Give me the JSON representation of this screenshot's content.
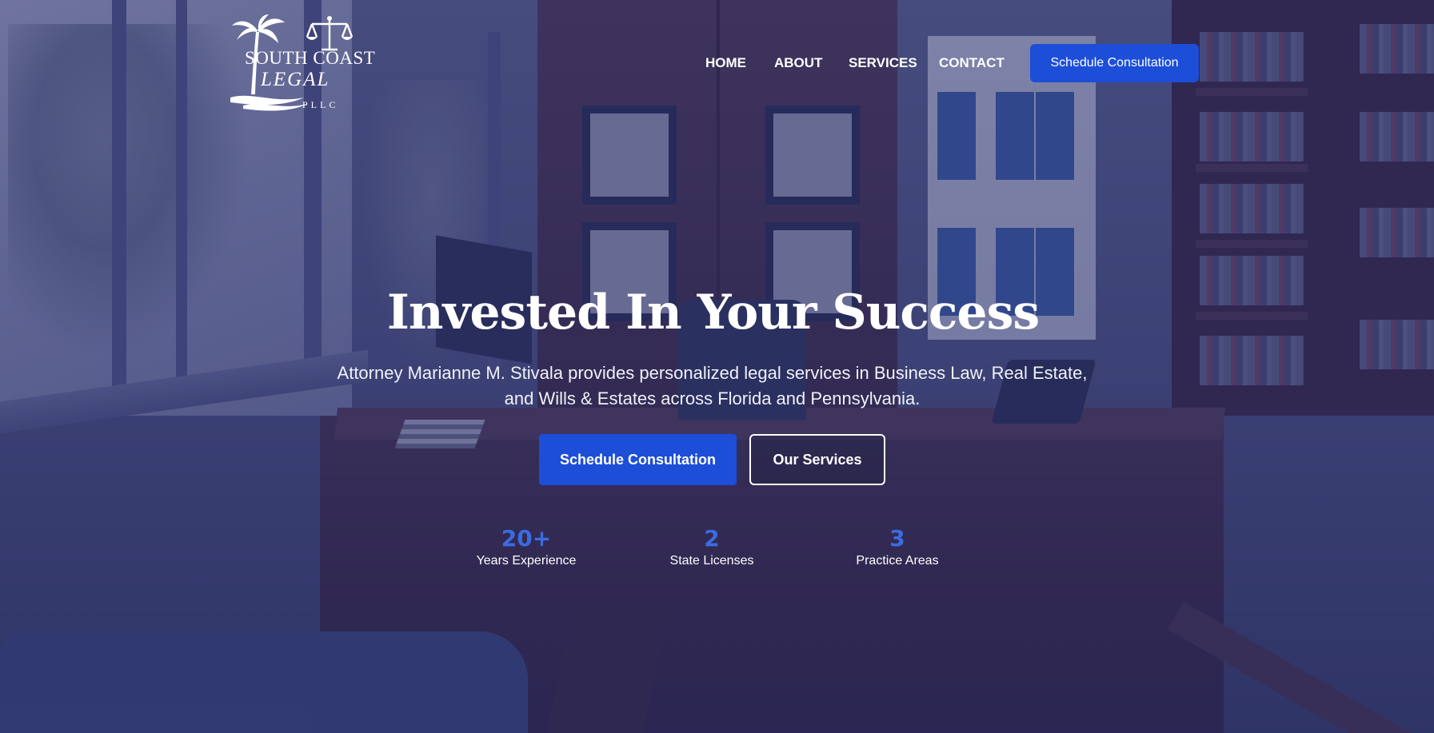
{
  "brand": {
    "logo_line1": "SOUTH COAST",
    "logo_line2": "LEGAL",
    "logo_line3": "PLLC"
  },
  "nav": {
    "items": [
      {
        "label": "HOME"
      },
      {
        "label": "ABOUT"
      },
      {
        "label": "SERVICES"
      },
      {
        "label": "CONTACT"
      }
    ],
    "cta_label": "Schedule Consultation"
  },
  "hero": {
    "title": "Invested In Your Success",
    "subtitle": "Attorney Marianne M. Stivala provides personalized legal services in Business Law, Real Estate, and Wills & Estates across Florida and Pennsylvania.",
    "primary_button": "Schedule Consultation",
    "secondary_button": "Our Services"
  },
  "stats": [
    {
      "value": "20+",
      "label": "Years Experience"
    },
    {
      "value": "2",
      "label": "State Licenses"
    },
    {
      "value": "3",
      "label": "Practice Areas"
    }
  ],
  "colors": {
    "accent": "#1d4ed8",
    "stat_number": "#3b6ce0",
    "overlay": "#262c68"
  },
  "icons": {
    "logo_palm": "palm-tree-icon",
    "logo_scales": "scales-of-justice-icon"
  }
}
